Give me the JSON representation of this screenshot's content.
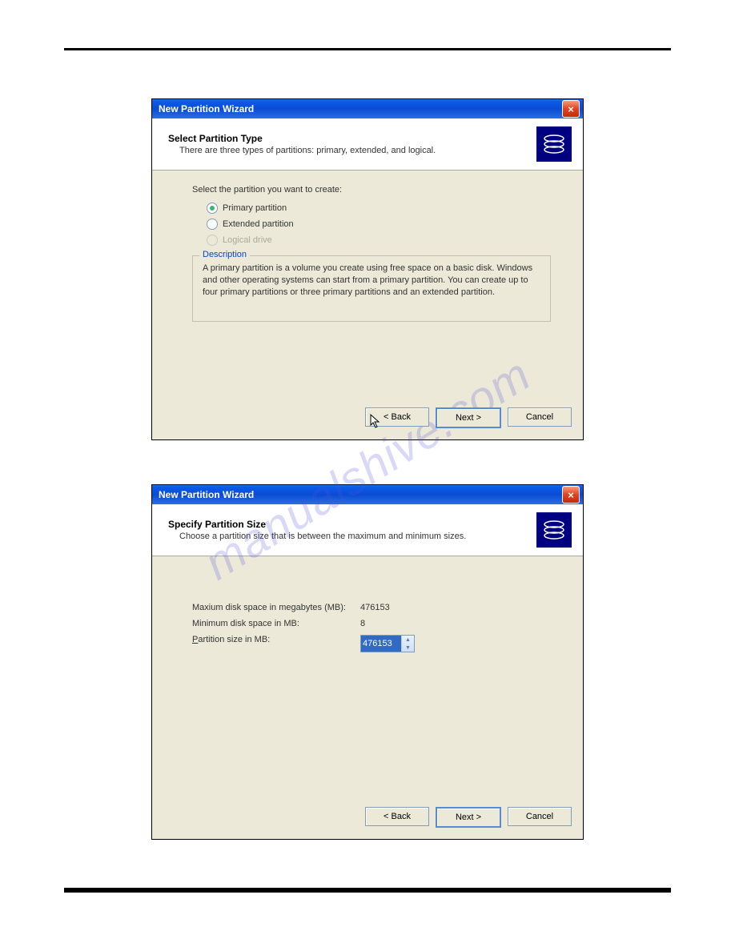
{
  "watermark": "manualshive.com",
  "dialog1": {
    "title": "New Partition Wizard",
    "close": "×",
    "heading": "Select Partition Type",
    "subheading": "There are three types of partitions: primary, extended, and logical.",
    "instruction": "Select the partition you want to create:",
    "options": {
      "primary": "Primary partition",
      "extended": "Extended partition",
      "logical": "Logical drive"
    },
    "descLegend": "Description",
    "descBody": "A primary partition is a volume you create using free space on a basic disk. Windows and other operating systems can start from a primary partition. You can create up to four primary partitions or three primary partitions and an extended partition.",
    "buttons": {
      "back": "< Back",
      "next": "Next >",
      "cancel": "Cancel"
    }
  },
  "dialog2": {
    "title": "New Partition Wizard",
    "close": "×",
    "heading": "Specify Partition Size",
    "subheading": "Choose a partition size that is between the maximum and minimum sizes.",
    "rows": {
      "maxLabel": "Maxium disk space in megabytes (MB):",
      "maxVal": "476153",
      "minLabel": "Minimum disk space in MB:",
      "minVal": "8",
      "sizeLabel": "Partition size in MB:",
      "sizeVal": "476153"
    },
    "buttons": {
      "back": "< Back",
      "next": "Next >",
      "cancel": "Cancel"
    }
  }
}
